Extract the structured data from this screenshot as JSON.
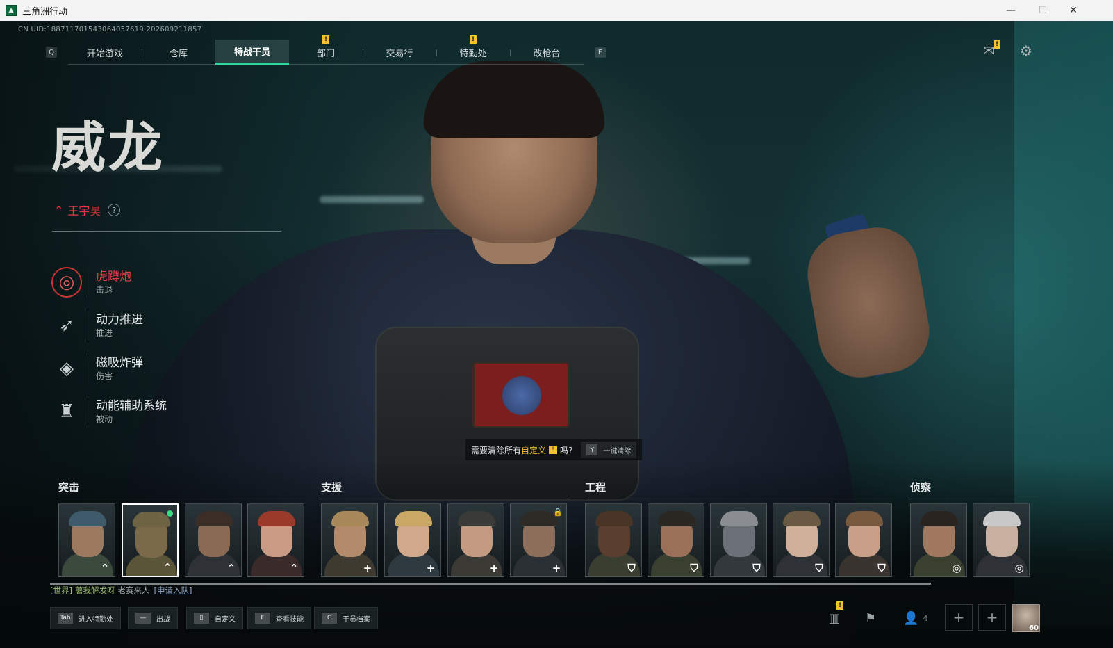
{
  "window": {
    "title": "三角洲行动",
    "min": "—",
    "max": "☐",
    "close": "✕"
  },
  "uid": "CN UID:188711701543064057619.202609211857",
  "nav": {
    "left_key": "Q",
    "right_key": "E",
    "tabs": [
      {
        "label": "开始游戏",
        "active": false,
        "badge": ""
      },
      {
        "label": "仓库",
        "active": false,
        "badge": ""
      },
      {
        "label": "特战干员",
        "active": true,
        "badge": ""
      },
      {
        "label": "部门",
        "active": false,
        "badge": "!"
      },
      {
        "label": "交易行",
        "active": false,
        "badge": ""
      },
      {
        "label": "特勤处",
        "active": false,
        "badge": "!"
      },
      {
        "label": "改枪台",
        "active": false,
        "badge": ""
      }
    ],
    "mail_badge": "!",
    "icons": {
      "mail": "mail-icon",
      "settings": "gear-icon"
    }
  },
  "operator": {
    "name": "威龙",
    "actor": "王宇昊",
    "help": "?",
    "skills": [
      {
        "name": "虎蹲炮",
        "type": "击退",
        "icon": "mortar-icon",
        "selected": true
      },
      {
        "name": "动力推进",
        "type": "推进",
        "icon": "dash-icon",
        "selected": false
      },
      {
        "name": "磁吸炸弹",
        "type": "伤害",
        "icon": "bomb-icon",
        "selected": false
      },
      {
        "name": "动能辅助系统",
        "type": "被动",
        "icon": "exo-icon",
        "selected": false
      }
    ]
  },
  "prompt": {
    "text_a": "需要清除所有",
    "highlight": "自定义",
    "mark": "!",
    "text_b": "吗?",
    "key": "Y",
    "button": "一键清除"
  },
  "roster": {
    "categories": [
      "突击",
      "支援",
      "工程",
      "侦察"
    ],
    "role_glyphs": {
      "assault": "⌃",
      "support": "+",
      "engineer": "⛉",
      "recon": "◎"
    }
  },
  "chat": {
    "channel": "[世界]",
    "user": "薯我解发呀",
    "message": "老赛来人",
    "apply": "[申请入队]"
  },
  "bottom": {
    "buttons": [
      {
        "key": "Tab",
        "label": "进入特勤处"
      },
      {
        "key": "—",
        "label": "出战"
      },
      {
        "key": "▯",
        "label": "自定义"
      },
      {
        "key": "F",
        "label": "查看技能"
      },
      {
        "key": "C",
        "label": "干员档案"
      }
    ],
    "stats_badge": "!",
    "squad_count": "4",
    "slot_plus": "+",
    "level": "60"
  },
  "colors": {
    "accent": "#2fd59a",
    "red": "#e2373f",
    "badge": "#f2c230"
  }
}
